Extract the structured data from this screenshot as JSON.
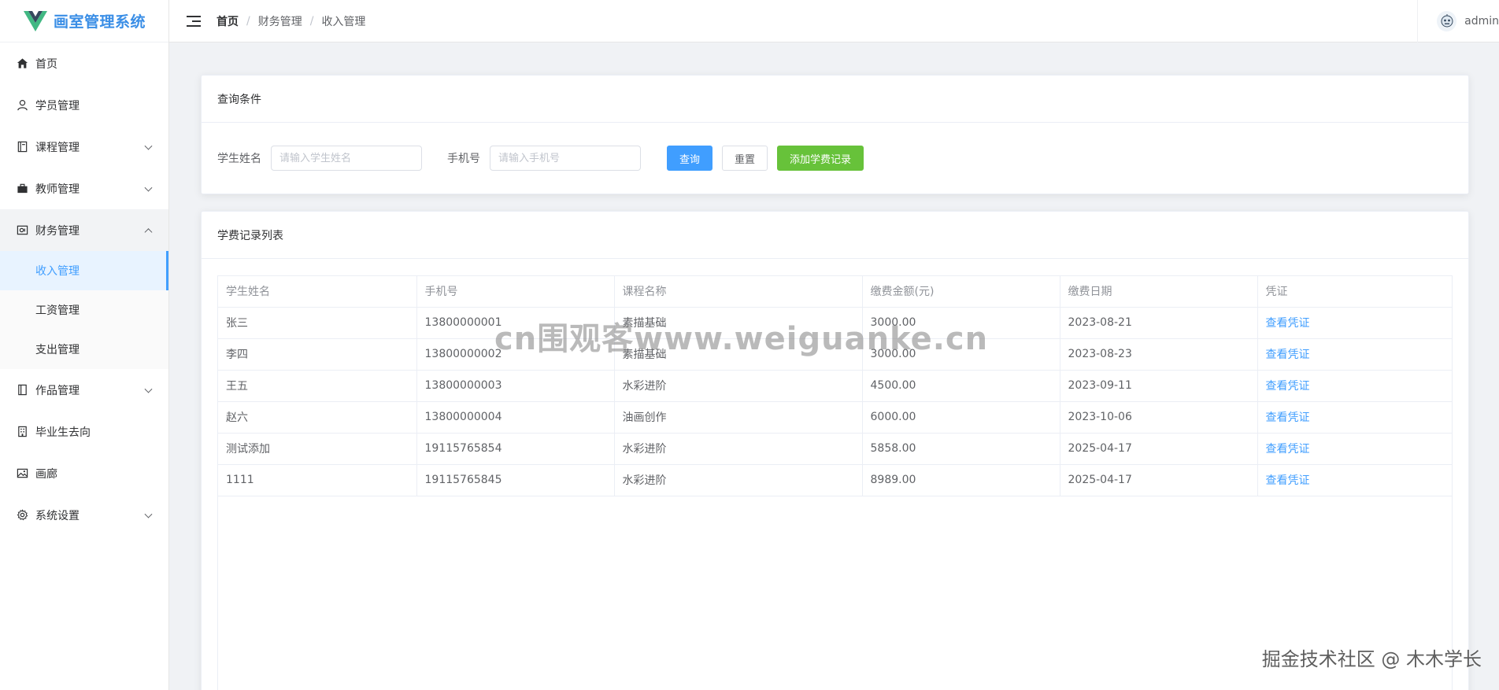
{
  "app": {
    "title": "画室管理系统"
  },
  "sidebar": {
    "items": [
      {
        "label": "首页",
        "icon": "home-icon"
      },
      {
        "label": "学员管理",
        "icon": "user-icon"
      },
      {
        "label": "课程管理",
        "icon": "book-icon",
        "expandable": true
      },
      {
        "label": "教师管理",
        "icon": "briefcase-icon",
        "expandable": true
      },
      {
        "label": "财务管理",
        "icon": "wallet-icon",
        "expandable": true,
        "expanded": true,
        "children": [
          {
            "label": "收入管理",
            "active": true
          },
          {
            "label": "工资管理"
          },
          {
            "label": "支出管理"
          }
        ]
      },
      {
        "label": "作品管理",
        "icon": "notebook-icon",
        "expandable": true
      },
      {
        "label": "毕业生去向",
        "icon": "building-icon"
      },
      {
        "label": "画廊",
        "icon": "picture-icon"
      },
      {
        "label": "系统设置",
        "icon": "gear-icon",
        "expandable": true
      }
    ]
  },
  "header": {
    "breadcrumb": [
      "首页",
      "财务管理",
      "收入管理"
    ],
    "username": "admin"
  },
  "search": {
    "title": "查询条件",
    "name_label": "学生姓名",
    "name_placeholder": "请输入学生姓名",
    "phone_label": "手机号",
    "phone_placeholder": "请输入手机号",
    "query_button": "查询",
    "reset_button": "重置",
    "add_button": "添加学费记录"
  },
  "table": {
    "title": "学费记录列表",
    "columns": [
      "学生姓名",
      "手机号",
      "课程名称",
      "缴费金额(元)",
      "缴费日期",
      "凭证"
    ],
    "rows": [
      [
        "张三",
        "13800000001",
        "素描基础",
        "3000.00",
        "2023-08-21",
        "查看凭证"
      ],
      [
        "李四",
        "13800000002",
        "素描基础",
        "3000.00",
        "2023-08-23",
        "查看凭证"
      ],
      [
        "王五",
        "13800000003",
        "水彩进阶",
        "4500.00",
        "2023-09-11",
        "查看凭证"
      ],
      [
        "赵六",
        "13800000004",
        "油画创作",
        "6000.00",
        "2023-10-06",
        "查看凭证"
      ],
      [
        "测试添加",
        "19115765854",
        "水彩进阶",
        "5858.00",
        "2025-04-17",
        "查看凭证"
      ],
      [
        "1111",
        "19115765845",
        "水彩进阶",
        "8989.00",
        "2025-04-17",
        "查看凭证"
      ]
    ]
  },
  "watermarks": {
    "center": "cn围观客www.weiguanke.cn",
    "corner": "掘金技术社区 @ 木木学长"
  },
  "colors": {
    "primary": "#409eff",
    "success": "#67c23a",
    "brand": "#3a8ee6",
    "logo_green": "#41b883",
    "logo_dark": "#35495e"
  }
}
